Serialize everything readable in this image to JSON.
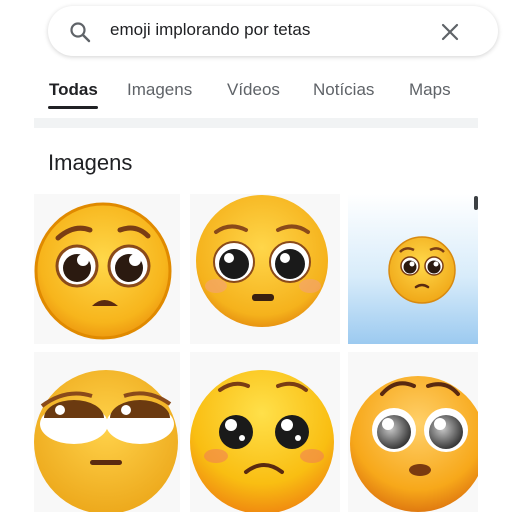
{
  "search": {
    "query": "emoji implorando por tetas",
    "icon": "search-icon",
    "clear_icon": "close-icon"
  },
  "tabs": [
    {
      "label": "Todas",
      "active": true
    },
    {
      "label": "Imagens",
      "active": false
    },
    {
      "label": "Vídeos",
      "active": false
    },
    {
      "label": "Notícias",
      "active": false
    },
    {
      "label": "Maps",
      "active": false
    }
  ],
  "section": {
    "title": "Imagens"
  },
  "results": [
    {
      "name": "pleading-face-emoji-1"
    },
    {
      "name": "pleading-face-emoji-2"
    },
    {
      "name": "pleading-face-emoji-3"
    },
    {
      "name": "pleading-face-emoji-4"
    },
    {
      "name": "pleading-face-emoji-5"
    },
    {
      "name": "pleading-face-emoji-6"
    }
  ],
  "colors": {
    "accent_text": "#202124",
    "muted_text": "#5f6368",
    "emoji_yellow": "#f7b51c",
    "emoji_outline": "#e08a00"
  }
}
